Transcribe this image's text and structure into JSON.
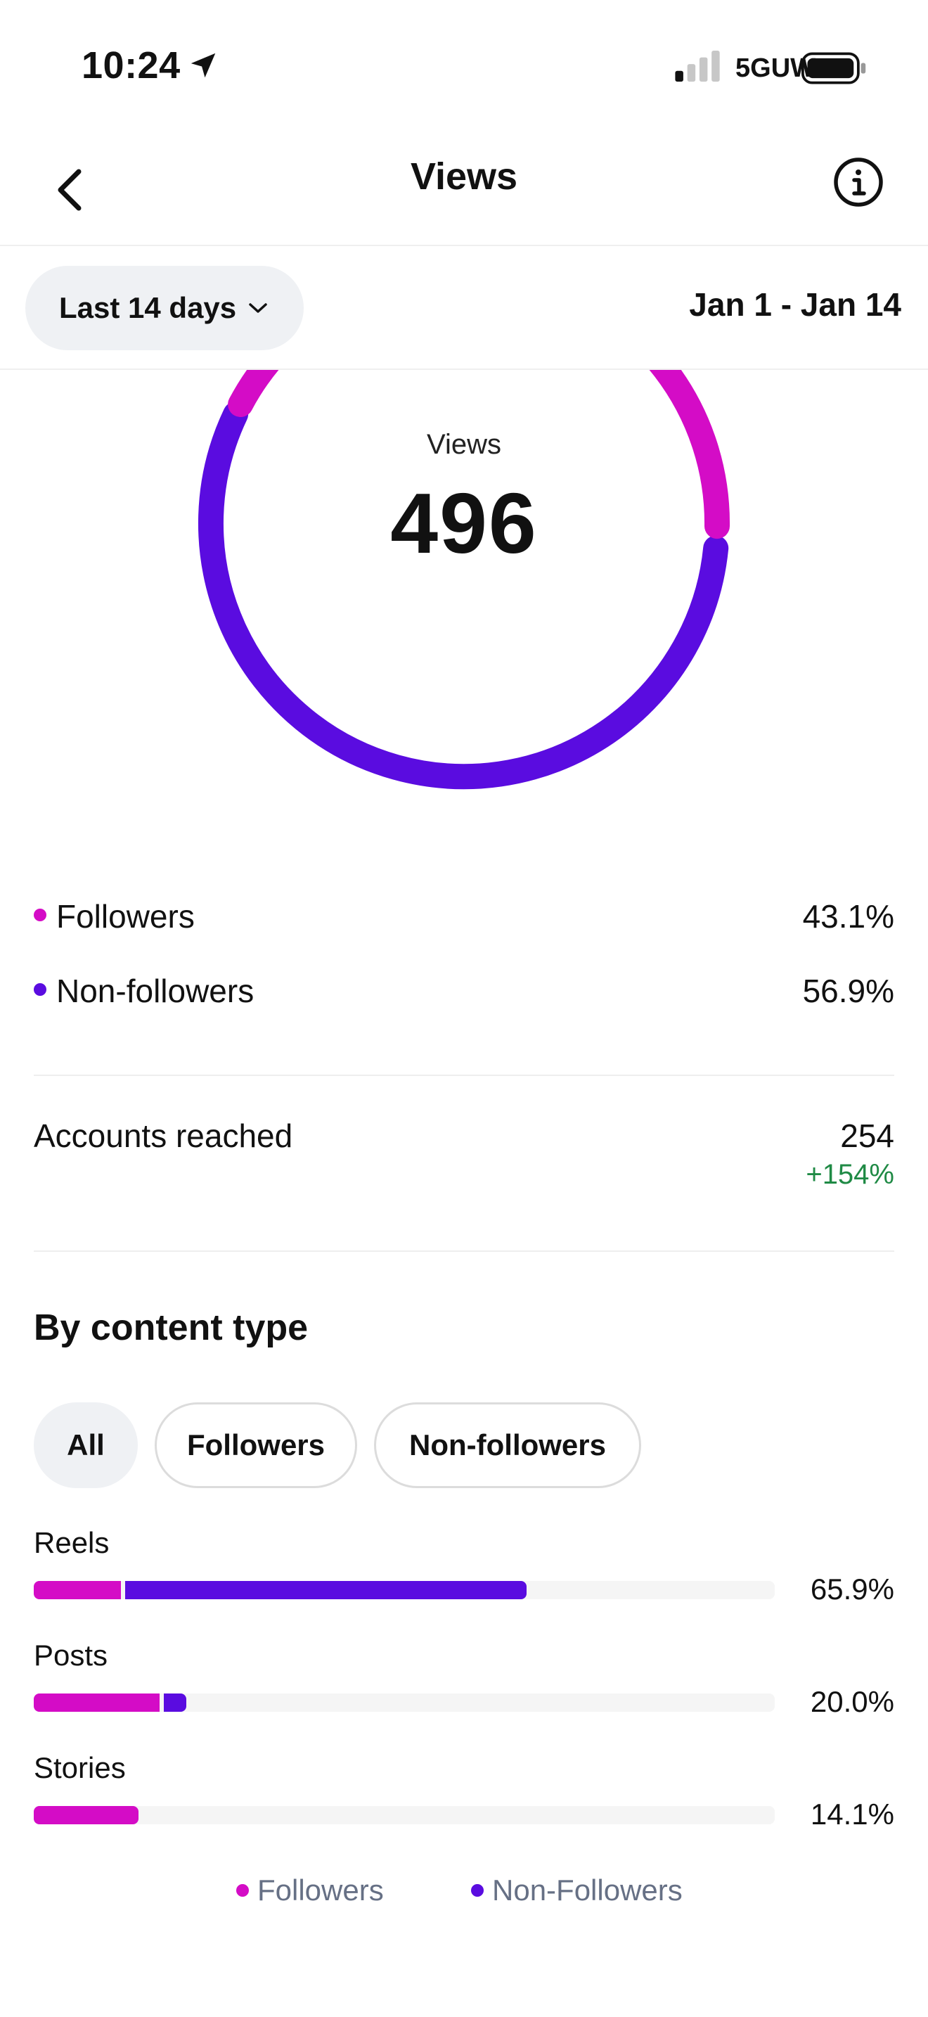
{
  "colors": {
    "followers": "#d40cc6",
    "non_followers": "#5a0ce0",
    "positive": "#1f8a45"
  },
  "status_bar": {
    "time": "10:24",
    "network": "5GUW",
    "icons": [
      "location-arrow-icon",
      "signal-icon",
      "battery-icon"
    ]
  },
  "header": {
    "title": "Views",
    "back_icon": "chevron-left-icon",
    "info_icon": "info-icon"
  },
  "filter": {
    "period": "Last 14 days",
    "date_range": "Jan 1 - Jan 14"
  },
  "donut": {
    "label": "Views",
    "value": "496",
    "followers_fraction": 0.431,
    "non_followers_fraction": 0.569
  },
  "split": [
    {
      "label": "Followers",
      "value": "43.1%"
    },
    {
      "label": "Non-followers",
      "value": "56.9%"
    }
  ],
  "reach": {
    "label": "Accounts reached",
    "value": "254",
    "change": "+154%"
  },
  "content_type": {
    "title": "By content type",
    "chips": [
      "All",
      "Followers",
      "Non-followers"
    ],
    "selected_chip": "All",
    "rows": [
      {
        "label": "Reels",
        "value": "65.9%",
        "followers_fraction": 0.118,
        "non_followers_fraction": 0.541
      },
      {
        "label": "Posts",
        "value": "20.0%",
        "followers_fraction": 0.17,
        "non_followers_fraction": 0.03
      },
      {
        "label": "Stories",
        "value": "14.1%",
        "followers_fraction": 0.141,
        "non_followers_fraction": 0.0
      }
    ],
    "legend": [
      "Followers",
      "Non-Followers"
    ]
  }
}
